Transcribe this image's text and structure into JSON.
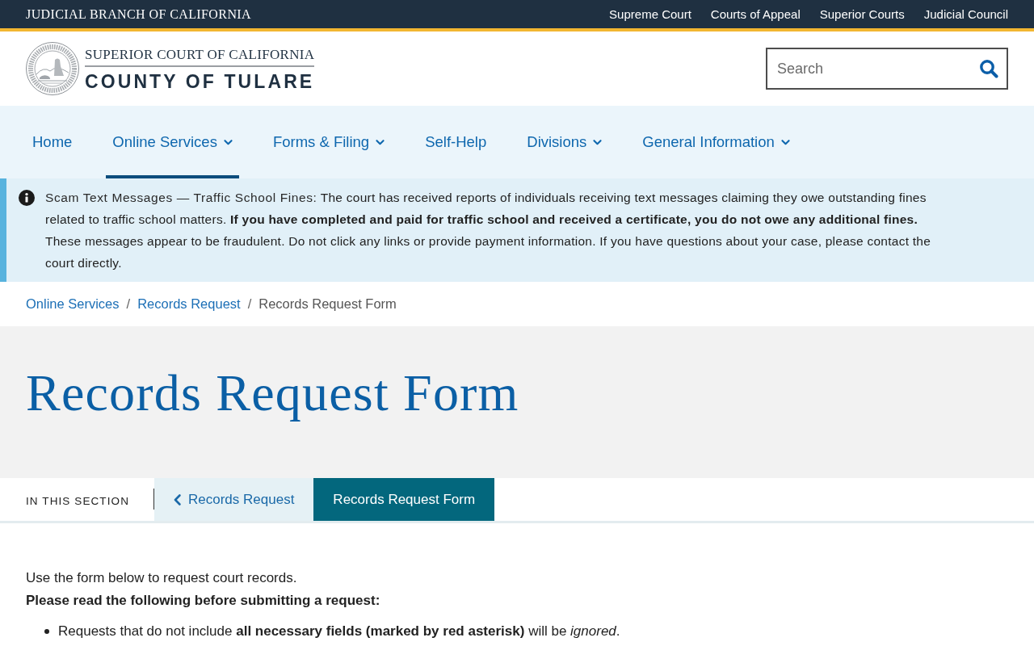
{
  "top_bar": {
    "title": "JUDICIAL BRANCH OF CALIFORNIA",
    "links": [
      "Supreme Court",
      "Courts of Appeal",
      "Superior Courts",
      "Judicial Council"
    ]
  },
  "header": {
    "logo": {
      "line_1": "SUPERIOR COURT OF CALIFORNIA",
      "line_2": "COUNTY OF TULARE"
    },
    "search": {
      "placeholder": "Search"
    }
  },
  "nav": {
    "items": [
      {
        "label": "Home",
        "has_menu": false,
        "selected": false
      },
      {
        "label": "Online Services",
        "has_menu": true,
        "selected": true
      },
      {
        "label": "Forms & Filing",
        "has_menu": true,
        "selected": false
      },
      {
        "label": "Self-Help",
        "has_menu": false,
        "selected": false
      },
      {
        "label": "Divisions",
        "has_menu": true,
        "selected": false
      },
      {
        "label": "General Information",
        "has_menu": true,
        "selected": false
      }
    ]
  },
  "alert": {
    "title": "Scam Text Messages — Traffic School Fines:",
    "text": "The court has received reports of individuals receiving text messages claiming they owe outstanding fines related to traffic school matters. **If you have completed and paid for traffic school and received a certificate, you do not owe any additional fines.** These messages appear to be fraudulent. Do not click any links or provide payment information. If you have questions about your case, please contact the court directly."
  },
  "breadcrumbs": {
    "items": [
      {
        "label": "Online Services",
        "kind": "link"
      },
      {
        "label": "Records Request",
        "kind": "link"
      },
      {
        "label": "Records Request Form",
        "kind": "current"
      }
    ],
    "separators": [
      "/",
      "/"
    ]
  },
  "page_title": "Records Request Form",
  "section_nav": {
    "label": "IN THIS SECTION",
    "tabs": [
      {
        "label": "Records Request",
        "kind": "parent",
        "selected": false
      },
      {
        "label": "Records Request Form",
        "kind": "page",
        "selected": true
      }
    ]
  },
  "content": {
    "intro": "Use the form below to request court records.",
    "notice": "Please read the following before submitting a request:",
    "bullets": [
      "Requests that do not include **all necessary fields (marked by red asterisk)** will be *ignored*."
    ]
  }
}
